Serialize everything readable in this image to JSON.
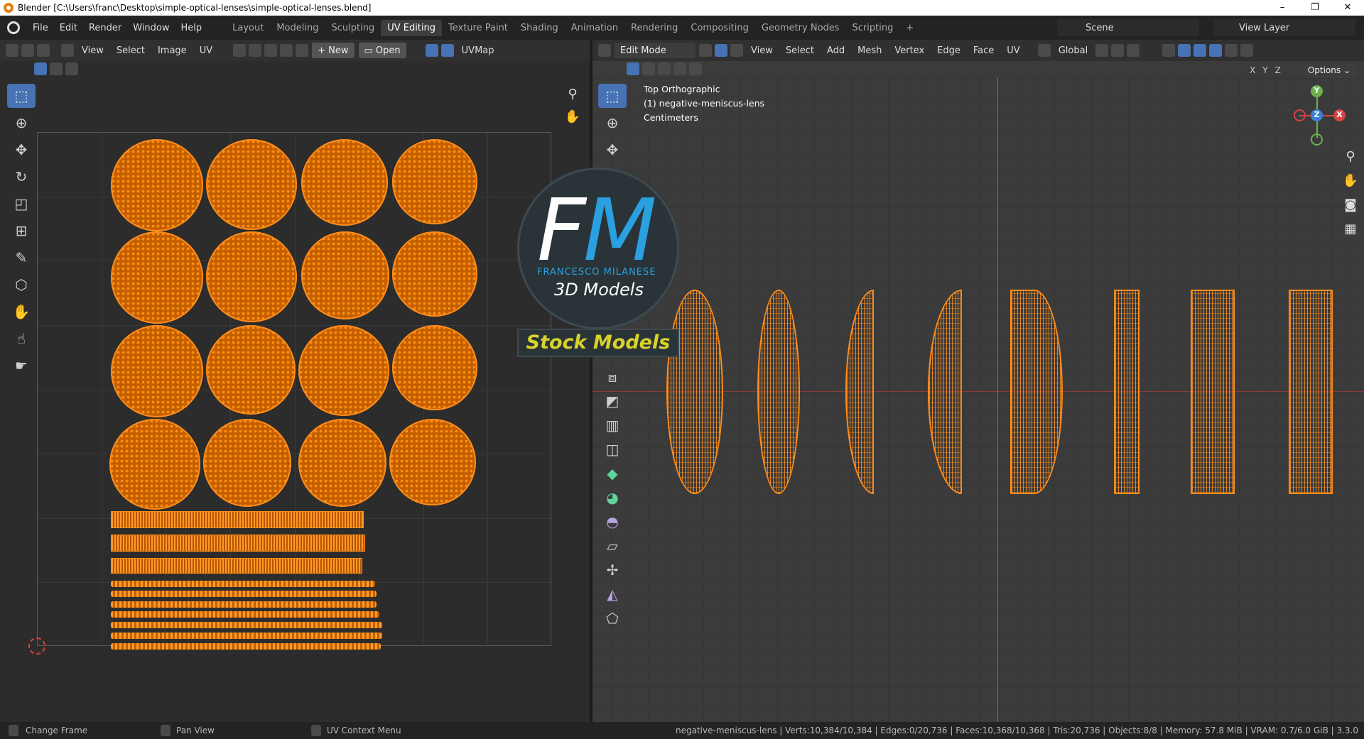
{
  "window": {
    "title": "Blender [C:\\Users\\franc\\Desktop\\simple-optical-lenses\\simple-optical-lenses.blend]"
  },
  "menu": [
    "File",
    "Edit",
    "Render",
    "Window",
    "Help"
  ],
  "workspaces": [
    "Layout",
    "Modeling",
    "Sculpting",
    "UV Editing",
    "Texture Paint",
    "Shading",
    "Animation",
    "Rendering",
    "Compositing",
    "Geometry Nodes",
    "Scripting"
  ],
  "scene": {
    "name": "Scene",
    "view_layer": "View Layer",
    "add_tab": "+"
  },
  "uv_editor": {
    "menus": [
      "View",
      "Select",
      "Image",
      "UV"
    ],
    "new_label": "New",
    "open_label": "Open",
    "uvmap_label": "UVMap"
  },
  "viewport": {
    "mode": "Edit Mode",
    "menus": [
      "View",
      "Select",
      "Add",
      "Mesh",
      "Vertex",
      "Edge",
      "Face",
      "UV"
    ],
    "orientation": "Global",
    "options_label": "Options",
    "axes_labels": [
      "X",
      "Y",
      "Z"
    ],
    "overlay_lines": [
      "Top Orthographic",
      "(1) negative-meniscus-lens",
      "Centimeters"
    ],
    "gizmo": {
      "x": "X",
      "y": "Y",
      "z": "Z"
    }
  },
  "watermark": {
    "logo": "FM",
    "name": "FRANCESCO MILANESE",
    "subtitle": "3D Models",
    "banner": "Stock Models"
  },
  "status": {
    "left": [
      "Change Frame",
      "Pan View",
      "UV Context Menu"
    ],
    "stats": "negative-meniscus-lens | Verts:10,384/10,384 | Edges:0/20,736 | Faces:10,368/10,368 | Tris:20,736 | Objects:8/8 | Memory: 57.8 MiB | VRAM: 0.7/6.0 GiB | 3.3.0"
  },
  "colors": {
    "accent": "#4772b3",
    "selection": "#ff8c1a",
    "watermark_blue": "#2aa0e0",
    "watermark_yellow": "#d8d22a"
  }
}
